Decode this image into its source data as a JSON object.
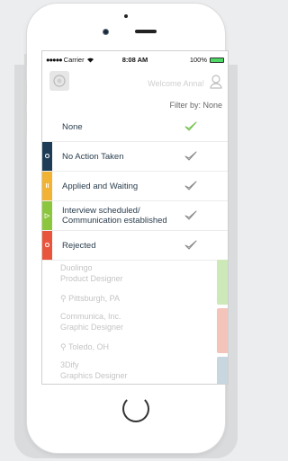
{
  "status_bar": {
    "carrier": "Carrier",
    "time": "8:08 AM",
    "battery": "100%"
  },
  "app_bar": {
    "welcome": "Welcome Anna!"
  },
  "filter": {
    "label": "Filter by: None"
  },
  "options": [
    {
      "label": "None",
      "marker": "",
      "color": "",
      "selected": true
    },
    {
      "label": "No Action Taken",
      "marker": "O",
      "color": "#1f3c56",
      "selected": false
    },
    {
      "label": "Applied and Waiting",
      "marker": "II",
      "color": "#f2b233",
      "selected": false
    },
    {
      "label": "Interview scheduled/\nCommunication established",
      "marker": "▷",
      "color": "#8cc63f",
      "selected": false
    },
    {
      "label": "Rejected",
      "marker": "O",
      "color": "#e8543c",
      "selected": false
    }
  ],
  "cards": [
    {
      "company": "Duolingo",
      "role": "Product Designer",
      "location": "Pittsburgh, PA",
      "tab_color": "#cde9b8"
    },
    {
      "company": "Communica, Inc.",
      "role": "Graphic Designer",
      "location": "Toledo, OH",
      "tab_color": "#f4c4ba"
    },
    {
      "company": "3Dify",
      "role": "Graphics Designer",
      "location": "",
      "tab_color": "#c8d6e0"
    }
  ],
  "colors": {
    "check_selected": "#6fc24a",
    "check_default": "#8a8a8a"
  },
  "icons": {
    "user": "user-icon",
    "check": "checkmark-icon",
    "location": "location-pin-icon"
  }
}
